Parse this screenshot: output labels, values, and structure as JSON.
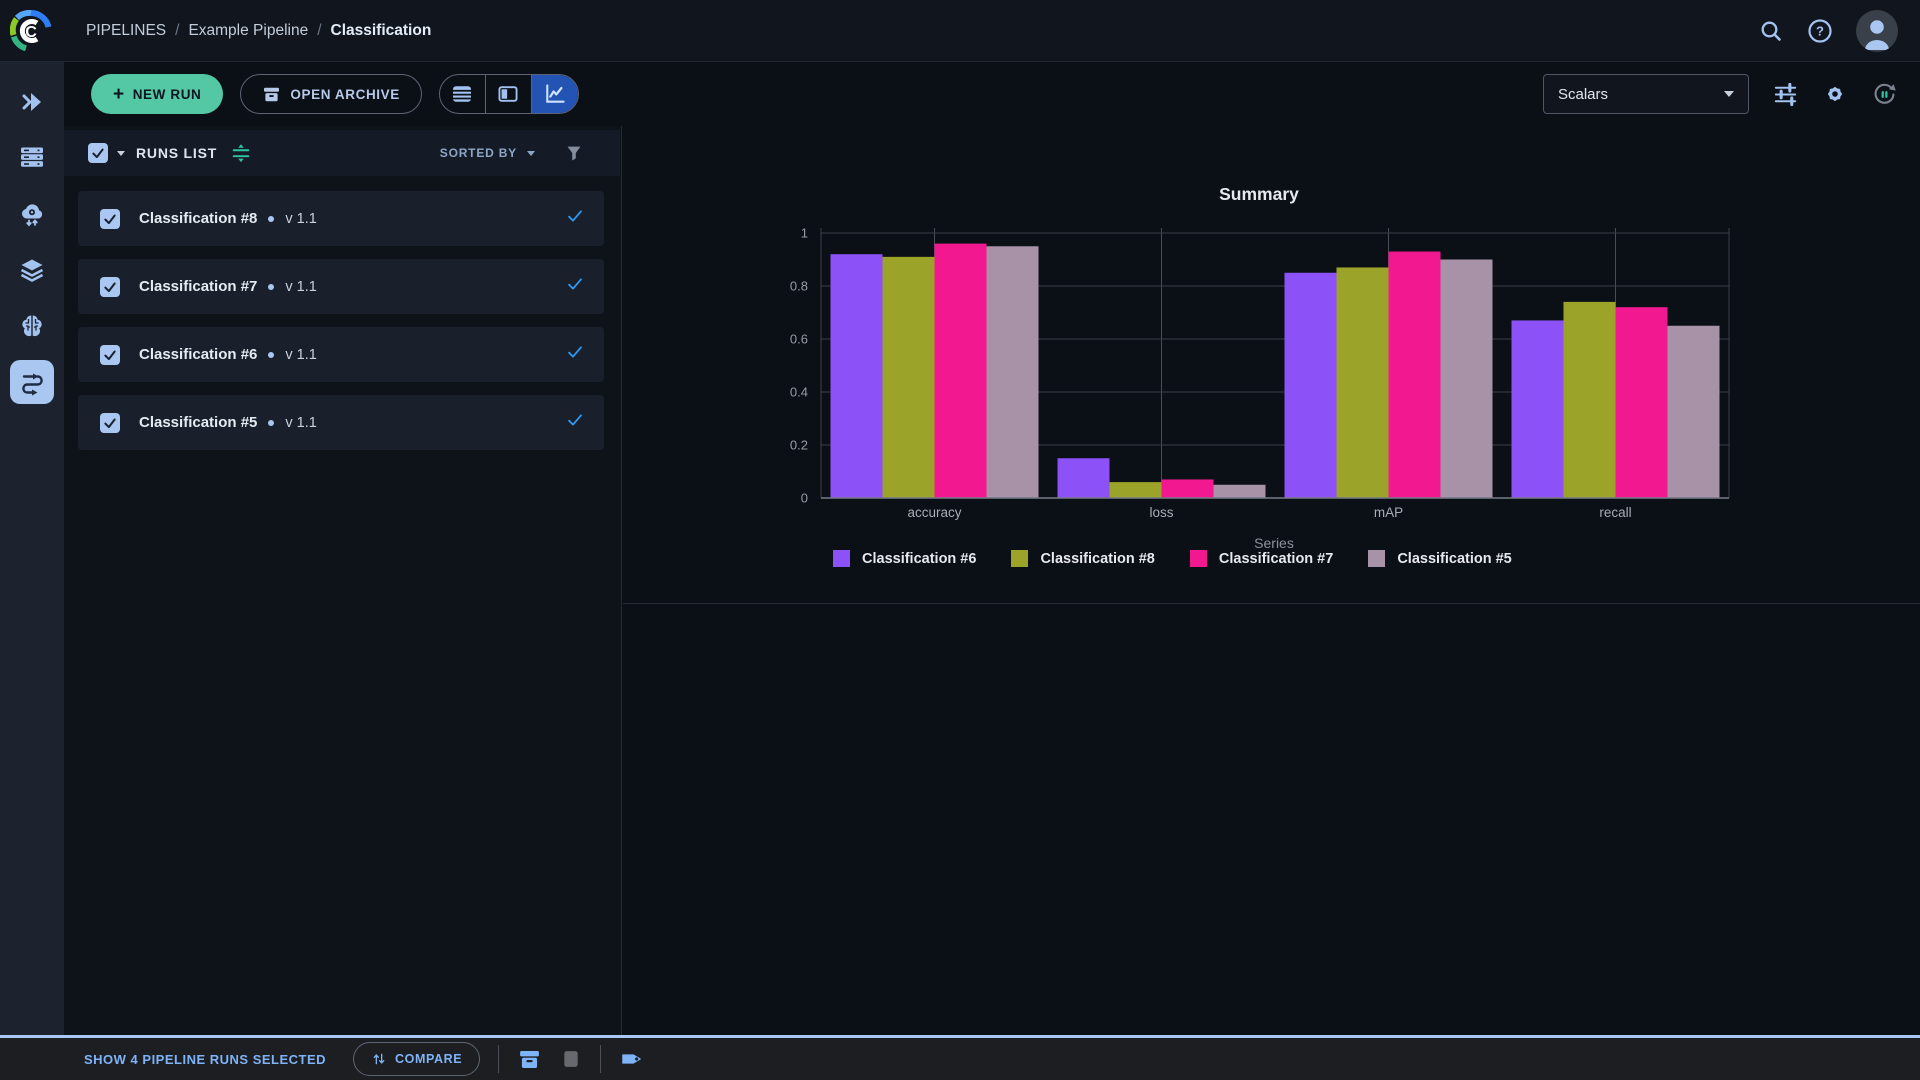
{
  "topbar": {
    "breadcrumb": {
      "root": "PIPELINES",
      "separator": "/",
      "project": "Example Pipeline",
      "page": "Classification"
    }
  },
  "toolbar": {
    "new_run_label": "NEW RUN",
    "open_archive_label": "OPEN ARCHIVE",
    "metric_selector_value": "Scalars"
  },
  "sidebar": {
    "active_item": "pipelines",
    "items": [
      "projects",
      "workers-queues",
      "cloud",
      "datasets",
      "models",
      "pipelines"
    ]
  },
  "runs_panel": {
    "title": "RUNS LIST",
    "sorted_by_label": "SORTED BY",
    "items": [
      {
        "name": "Classification #8",
        "version": "v 1.1",
        "checked": true
      },
      {
        "name": "Classification #7",
        "version": "v 1.1",
        "checked": true
      },
      {
        "name": "Classification #6",
        "version": "v 1.1",
        "checked": true
      },
      {
        "name": "Classification #5",
        "version": "v 1.1",
        "checked": true
      }
    ]
  },
  "chart_data": {
    "type": "bar",
    "title": "Summary",
    "categories": [
      "accuracy",
      "loss",
      "mAP",
      "recall"
    ],
    "series": [
      {
        "name": "Classification #6",
        "color": "#8c52f7",
        "values": [
          0.92,
          0.15,
          0.85,
          0.67
        ]
      },
      {
        "name": "Classification #8",
        "color": "#9ba328",
        "values": [
          0.91,
          0.06,
          0.87,
          0.74
        ]
      },
      {
        "name": "Classification #7",
        "color": "#f2188f",
        "values": [
          0.96,
          0.07,
          0.93,
          0.72
        ]
      },
      {
        "name": "Classification #5",
        "color": "#a892a7",
        "values": [
          0.95,
          0.05,
          0.9,
          0.65
        ]
      }
    ],
    "xlabel": "Series",
    "ylim": [
      0,
      1
    ],
    "yticks": [
      0,
      0.2,
      0.4,
      0.6,
      0.8,
      1
    ],
    "grid": true,
    "legend_position": "bottom-left"
  },
  "footer": {
    "selection_label": "SHOW 4 PIPELINE RUNS SELECTED",
    "compare_label": "COMPARE"
  },
  "colors": {
    "accent_mint": "#54c8a4",
    "active_nav_blue": "#2354b4",
    "selection_light_blue": "#a9c7f0",
    "teal": "#2fc5a2",
    "link_blue": "#7fb3f7",
    "check_blue": "#2e9bf5",
    "chart_bg": "#0b0f16"
  }
}
